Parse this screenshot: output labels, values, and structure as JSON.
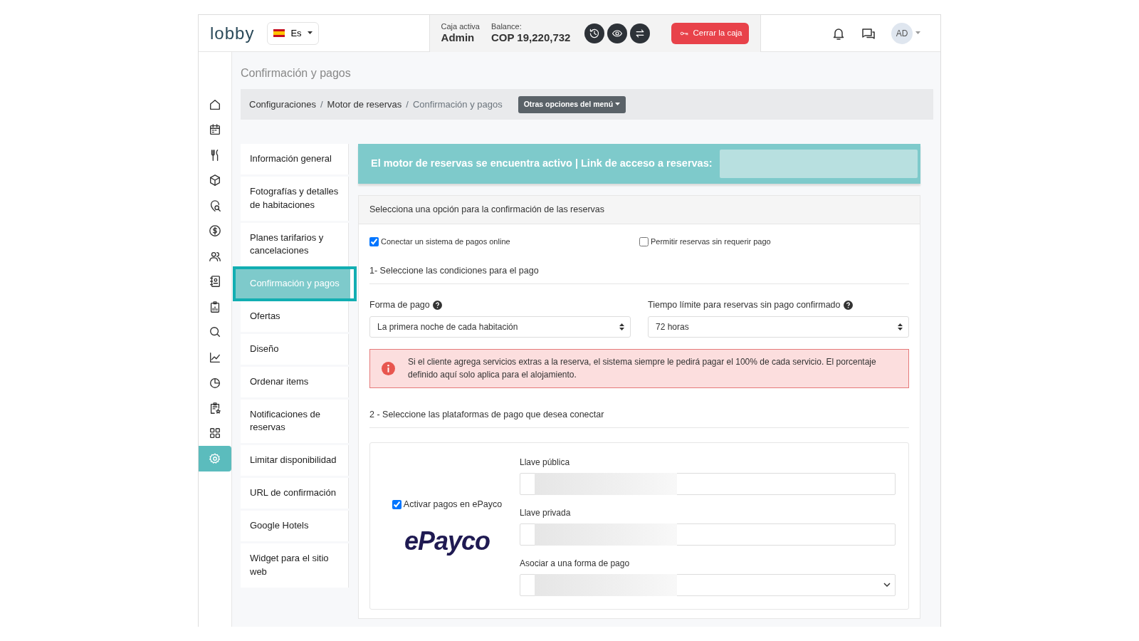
{
  "header": {
    "logo": "lobby",
    "language": "Es",
    "cash_label": "Caja activa",
    "cash_value": "Admin",
    "balance_label": "Balance:",
    "balance_value": "COP 19,220,732",
    "close_button": "Cerrar la caja",
    "user_initials": "AD"
  },
  "icon_rail": [
    {
      "selected": false
    },
    {
      "selected": false
    },
    {
      "selected": false
    },
    {
      "selected": false
    },
    {
      "selected": false
    },
    {
      "selected": false
    },
    {
      "selected": false
    },
    {
      "selected": false
    },
    {
      "selected": false
    },
    {
      "selected": false
    },
    {
      "selected": false
    },
    {
      "selected": false
    },
    {
      "selected": false
    },
    {
      "selected": false
    },
    {
      "selected": true
    }
  ],
  "page_title": "Confirmación y pagos",
  "breadcrumb": [
    {
      "label": "Configuraciones",
      "current": false
    },
    {
      "separator": "/",
      "label": "Motor de reservas",
      "current": false
    },
    {
      "separator": "/",
      "label": "Confirmación y pagos",
      "current": true
    }
  ],
  "menu_button": "Otras opciones del menú",
  "settings_menu": [
    {
      "label": "Información general",
      "selected": false
    },
    {
      "label": "Fotografías y detalles de habitaciones",
      "selected": false
    },
    {
      "label": "Planes tarifarios y cancelaciones",
      "selected": false
    },
    {
      "label": "Confirmación y pagos",
      "selected": true
    },
    {
      "label": "Ofertas",
      "selected": false
    },
    {
      "label": "Diseño",
      "selected": false
    },
    {
      "label": "Ordenar items",
      "selected": false
    },
    {
      "label": "Notificaciones de reservas",
      "selected": false
    },
    {
      "label": "Limitar disponibilidad",
      "selected": false
    },
    {
      "label": "URL de confirmación",
      "selected": false
    },
    {
      "label": "Google Hotels",
      "selected": false
    },
    {
      "label": "Widget para el sitio web",
      "selected": false
    }
  ],
  "banner": "El motor de reservas se encuentra activo | Link de acceso a reservas:",
  "confirmation": {
    "title": "Selecciona una opción para la confirmación de las reservas",
    "options": [
      {
        "label": "Conectar un sistema de pagos online",
        "checked": true
      },
      {
        "label": "Permitir reservas sin requerir pago",
        "checked": false
      }
    ],
    "section_1": "1- Seleccione las condiciones para el pago",
    "fields": [
      {
        "label": "Forma de pago",
        "value": "La primera noche de cada habitación"
      },
      {
        "label": "Tiempo límite para reservas sin pago confirmado",
        "value": "72 horas"
      }
    ],
    "alert": "Si el cliente agrega servicios extras a la reserva, el sistema siempre le pedirá pagar el 100% de cada servicio. El porcentaje definido aquí solo aplica para el alojamiento.",
    "section_2": "2 - Seleccione las plataformas de pago que desea conectar",
    "gateway": {
      "label": "Activar pagos en ePayco",
      "checked": true,
      "logo": "ePayco",
      "fields": [
        {
          "label": "Llave pública",
          "kind": "text"
        },
        {
          "label": "Llave privada",
          "kind": "text"
        },
        {
          "label": "Asociar a una forma de pago",
          "kind": "select"
        }
      ]
    }
  }
}
